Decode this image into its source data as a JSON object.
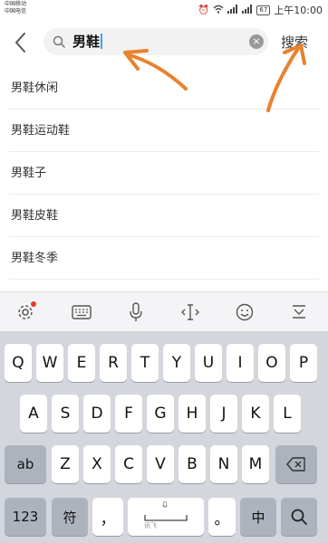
{
  "status": {
    "carrier1": "中国移动",
    "carrier2": "中国电信",
    "battery": "67",
    "time": "上午10:00"
  },
  "search": {
    "value": "男鞋",
    "submit_label": "搜索"
  },
  "suggestions": [
    "男鞋休闲",
    "男鞋运动鞋",
    "男鞋子",
    "男鞋皮鞋",
    "男鞋冬季"
  ],
  "keyboard": {
    "row1": [
      "Q",
      "W",
      "E",
      "R",
      "T",
      "Y",
      "U",
      "I",
      "O",
      "P"
    ],
    "row2": [
      "A",
      "S",
      "D",
      "F",
      "G",
      "H",
      "J",
      "K",
      "L"
    ],
    "row3": [
      "Z",
      "X",
      "C",
      "V",
      "B",
      "N",
      "M"
    ],
    "shift_label": "ab",
    "num_label": "123",
    "symbol_label": "符",
    "comma_label": "，",
    "period_label": "。",
    "lang_label": "中",
    "space_hint": "讯飞"
  },
  "colors": {
    "annotation": "#e8822e",
    "caret": "#3aa0ff",
    "badge": "#e53935"
  }
}
